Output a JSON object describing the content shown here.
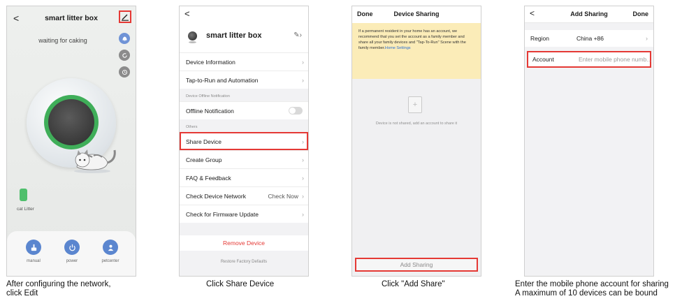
{
  "panel1": {
    "back": "<",
    "title": "smart litter box",
    "status": "waiting for caking",
    "litter_label": "cat Litter",
    "dock": [
      {
        "label": "manual",
        "icon": "brush-icon"
      },
      {
        "label": "power",
        "icon": "power-icon"
      },
      {
        "label": "petcenter",
        "icon": "pet-icon"
      }
    ],
    "caption_line1": "After configuring the network,",
    "caption_line2": "click Edit"
  },
  "panel2": {
    "back": "<",
    "device_name": "smart litter box",
    "rows": {
      "device_information": "Device Information",
      "tap_to_run": "Tap-to-Run and Automation",
      "offline_section": "Device Offline Notification",
      "offline_notification": "Offline Notification",
      "others_section": "Others",
      "share_device": "Share Device",
      "create_group": "Create Group",
      "faq": "FAQ & Feedback",
      "check_network": "Check Device Network",
      "check_now": "Check Now",
      "firmware": "Check for Firmware Update"
    },
    "remove_device": "Remove Device",
    "restore": "Restore Factory Defaults",
    "caption": "Click Share Device"
  },
  "panel3": {
    "done": "Done",
    "title": "Device Sharing",
    "notice": "If a permanent resident in your home has an account, we recommend that you set the account as a family member and share all your family devices and \"Tap-To-Run\" Scene with the family member.",
    "notice_link": "Home Settings",
    "empty_text": "Device is not shared, add an account to share it",
    "add_sharing": "Add Sharing",
    "caption": "Click \"Add Share\""
  },
  "panel4": {
    "back": "<",
    "title": "Add Sharing",
    "done": "Done",
    "region_label": "Region",
    "region_value": "China +86",
    "account_label": "Account",
    "account_placeholder": "Enter mobile phone numb...",
    "caption_line1": "Enter the mobile phone account for sharing",
    "caption_line2": "A maximum of 10 devices can be bound"
  },
  "colors": {
    "highlight": "#e53935",
    "accent_green": "#3fae59",
    "accent_blue": "#5b86cf",
    "link_blue": "#2d6fd2",
    "notice_bg": "#fbecb8"
  }
}
